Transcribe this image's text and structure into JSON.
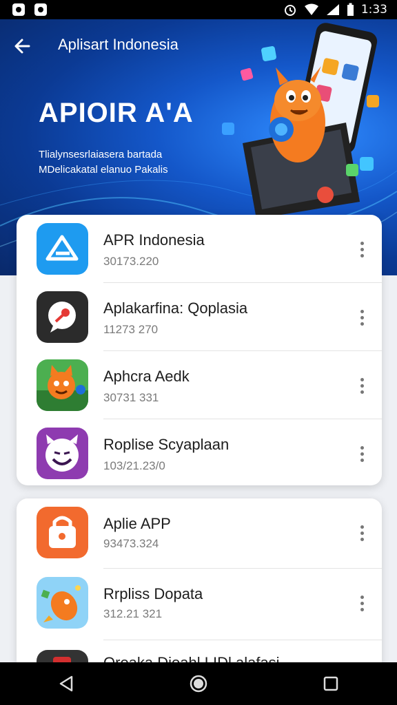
{
  "status_bar": {
    "time": "1:33",
    "icons": [
      "notification-icon",
      "notification-icon",
      "alarm-icon",
      "wifi-icon",
      "signal-icon",
      "battery-icon"
    ]
  },
  "header": {
    "back_icon": "arrow-left-icon",
    "title": "Aplisart Indonesia",
    "heading": "APIOIR A'A",
    "subtitle_line1": "Tlialynsesrlaiasera bartada",
    "subtitle_line2": "MDelicakatal elanuo Pakalis"
  },
  "apps": [
    {
      "name": "APR Indonesia",
      "meta": "30173.220",
      "icon": "app-a-logo-icon",
      "color": "#1e9bf0"
    },
    {
      "name": "Aplakarfina: Qoplasia",
      "meta": "11273 270",
      "icon": "map-pin-bubble-icon",
      "color": "#2b2b2b"
    },
    {
      "name": "Aphcra Aedk",
      "meta": "30731 331",
      "icon": "cartoon-cat-icon",
      "color": "#4caf50"
    },
    {
      "name": "Roplise Scyaplaan",
      "meta": "103/21.23/0",
      "icon": "grinning-face-icon",
      "color": "#8e3bb0"
    },
    {
      "name": "Aplie APP",
      "meta": "93473.324",
      "icon": "lock-bag-icon",
      "color": "#f26a2e"
    },
    {
      "name": "Rrpliss Dopata",
      "meta": "312.21 321",
      "icon": "rocket-mascot-icon",
      "color": "#8fd3f7"
    },
    {
      "name": "Oroaka Dioahl LIDl.alafasi",
      "meta": "",
      "icon": "partial-app-icon",
      "color": "#333333"
    }
  ],
  "nav": {
    "back": "triangle-back-icon",
    "home": "circle-home-icon",
    "recents": "square-recents-icon"
  },
  "colors": {
    "header_dark": "#09296a",
    "header_light": "#2f8bff",
    "card_bg": "#ffffff",
    "page_bg": "#eef0f4"
  }
}
